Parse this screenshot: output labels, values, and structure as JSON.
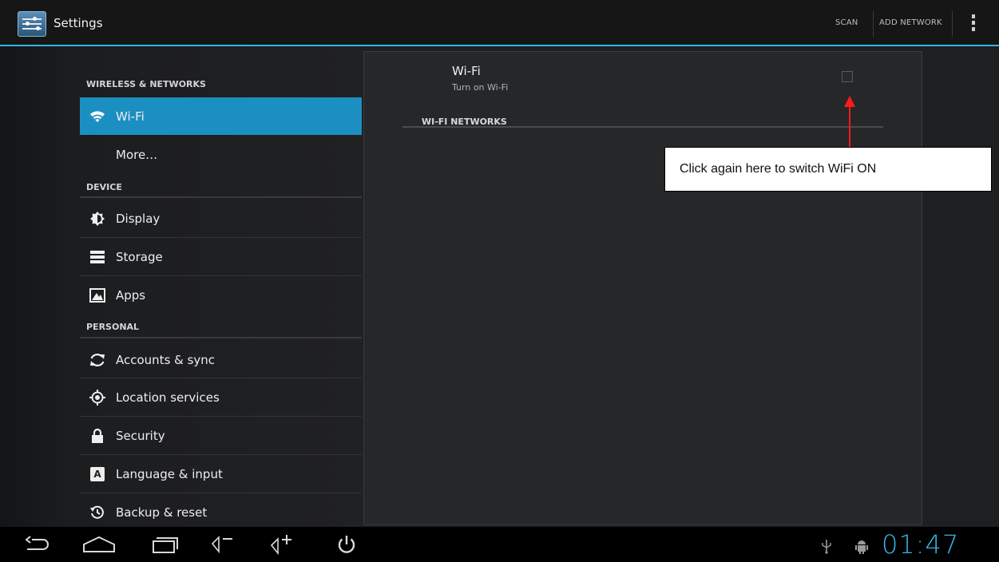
{
  "actionbar": {
    "title": "Settings",
    "scan_label": "SCAN",
    "add_network_label": "ADD NETWORK"
  },
  "sidebar": {
    "sections": {
      "wireless": "WIRELESS & NETWORKS",
      "device": "DEVICE",
      "personal": "PERSONAL"
    },
    "items": [
      {
        "label": "Wi-Fi",
        "icon": "wifi-icon"
      },
      {
        "label": "More…"
      },
      {
        "label": "Display",
        "icon": "brightness-icon"
      },
      {
        "label": "Storage",
        "icon": "storage-icon"
      },
      {
        "label": "Apps",
        "icon": "apps-icon"
      },
      {
        "label": "Accounts & sync",
        "icon": "sync-icon"
      },
      {
        "label": "Location services",
        "icon": "location-icon"
      },
      {
        "label": "Security",
        "icon": "lock-icon"
      },
      {
        "label": "Language & input",
        "icon": "keyboard-icon"
      },
      {
        "label": "Backup & reset",
        "icon": "backup-icon"
      }
    ]
  },
  "detail": {
    "wifi_title": "Wi-Fi",
    "wifi_summary": "Turn on Wi-Fi",
    "wifi_checked": false,
    "networks_header": "WI-FI NETWORKS"
  },
  "annotation": {
    "callout_text": "Click again here to switch WiFi ON",
    "color": "#ff1a1a"
  },
  "systembar": {
    "clock": "01:47"
  },
  "colors": {
    "accent": "#33b5e5",
    "selected": "#1c8fc2"
  }
}
